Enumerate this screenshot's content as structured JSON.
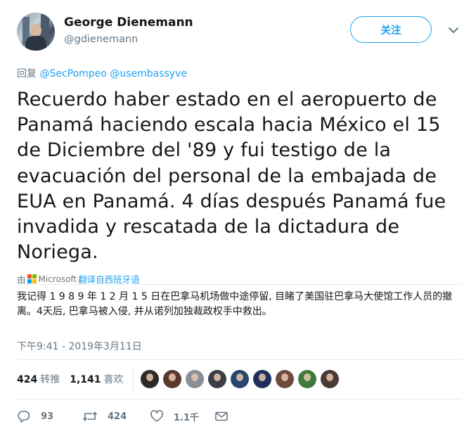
{
  "author": {
    "name": "George Dienemann",
    "handle": "@gdienemann"
  },
  "follow_label": "关注",
  "reply": {
    "prefix": "回复",
    "mentions": [
      "@SecPompeo",
      "@usembassyve"
    ]
  },
  "tweet_text": "Recuerdo haber estado en el aeropuerto de Panamá haciendo escala hacia México el 15 de Diciembre del '89 y fui testigo de la evacuación del personal de la embajada de EUA en Panamá. 4 días después Panamá fue invadida y rescatada de la dictadura de Noriega.",
  "translation": {
    "by_prefix": "由",
    "provider": "Microsoft",
    "link_text": "翻译自西班牙语",
    "text": "我记得 1 9 8 9 年 1 2 月 1 5 日在巴拿马机场做中途停留, 目睹了美国驻巴拿马大使馆工作人员的撤离。4天后, 巴拿马被入侵, 并从诺列加独裁政权手中救出。"
  },
  "timestamp": "下午9:41 - 2019年3月11日",
  "stats": {
    "retweets_count": "424",
    "retweets_label": "转推",
    "likes_count": "1,141",
    "likes_label": "喜欢"
  },
  "liker_avatar_colors": [
    "#2d2a2a",
    "#5b3a2e",
    "#8a8f96",
    "#3c3c46",
    "#26466b",
    "#1f2f5c",
    "#6e4b3f",
    "#3f7a3a",
    "#4a3a36"
  ],
  "actions": {
    "reply_count": "93",
    "retweet_count": "424",
    "like_count": "1.1千"
  },
  "colors": {
    "accent": "#1da1f2",
    "muted": "#657786",
    "text": "#14171a"
  }
}
